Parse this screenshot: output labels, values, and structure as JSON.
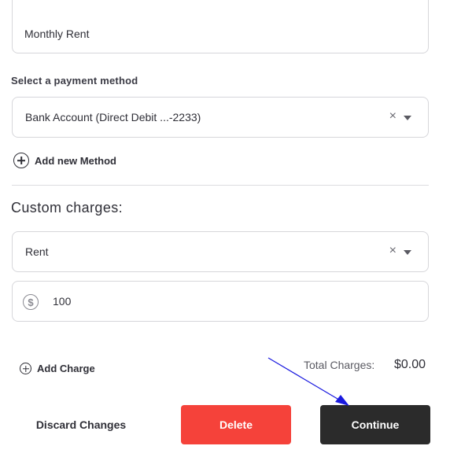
{
  "charge_description": {
    "value": "Monthly Rent"
  },
  "payment": {
    "label": "Select a payment method",
    "selected": "Bank Account (Direct Debit ...-2233)",
    "clear_glyph": "×",
    "add_method_label": "Add new Method"
  },
  "custom_charges": {
    "title": "Custom charges:",
    "charge_type": {
      "selected": "Rent",
      "clear_glyph": "×"
    },
    "amount": {
      "currency_glyph": "$",
      "value": "100"
    },
    "add_charge_label": "Add Charge"
  },
  "totals": {
    "label": "Total Charges:",
    "value": "$0.00"
  },
  "actions": {
    "discard_label": "Discard Changes",
    "delete_label": "Delete",
    "continue_label": "Continue"
  },
  "colors": {
    "delete_button": "#f5423a",
    "continue_button": "#2b2b2b",
    "annotation_arrow": "#1a1adf"
  },
  "icons": {
    "clear": "close-icon",
    "dropdown": "chevron-down-icon",
    "add": "plus-circle-icon",
    "currency": "dollar-circle-icon"
  }
}
